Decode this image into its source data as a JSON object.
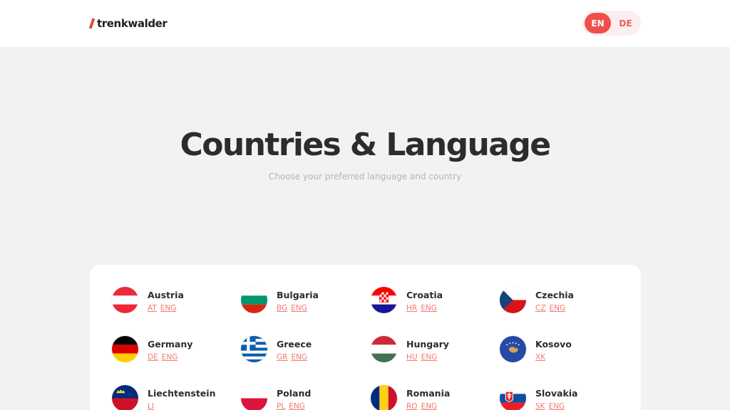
{
  "header": {
    "logo_text": "trenkwalder",
    "languages": [
      {
        "label": "EN",
        "active": true
      },
      {
        "label": "DE",
        "active": false
      }
    ]
  },
  "hero": {
    "title": "Countries & Language",
    "subtitle": "Choose your preferred language and country"
  },
  "countries": [
    {
      "name": "Austria",
      "links": [
        "AT",
        "ENG"
      ],
      "flag": "austria-flag-icon"
    },
    {
      "name": "Bulgaria",
      "links": [
        "BG",
        "ENG"
      ],
      "flag": "bulgaria-flag-icon"
    },
    {
      "name": "Croatia",
      "links": [
        "HR",
        "ENG"
      ],
      "flag": "croatia-flag-icon"
    },
    {
      "name": "Czechia",
      "links": [
        "CZ",
        "ENG"
      ],
      "flag": "czechia-flag-icon"
    },
    {
      "name": "Germany",
      "links": [
        "DE",
        "ENG"
      ],
      "flag": "germany-flag-icon"
    },
    {
      "name": "Greece",
      "links": [
        "GR",
        "ENG"
      ],
      "flag": "greece-flag-icon"
    },
    {
      "name": "Hungary",
      "links": [
        "HU",
        "ENG"
      ],
      "flag": "hungary-flag-icon"
    },
    {
      "name": "Kosovo",
      "links": [
        "XK"
      ],
      "flag": "kosovo-flag-icon"
    },
    {
      "name": "Liechtenstein",
      "links": [
        "LI"
      ],
      "flag": "liechtenstein-flag-icon"
    },
    {
      "name": "Poland",
      "links": [
        "PL",
        "ENG"
      ],
      "flag": "poland-flag-icon"
    },
    {
      "name": "Romania",
      "links": [
        "RO",
        "ENG"
      ],
      "flag": "romania-flag-icon"
    },
    {
      "name": "Slovakia",
      "links": [
        "SK",
        "ENG"
      ],
      "flag": "slovakia-flag-icon"
    }
  ],
  "colors": {
    "accent": "#f0504a",
    "link": "#f07a72",
    "background": "#f2f2f2"
  }
}
